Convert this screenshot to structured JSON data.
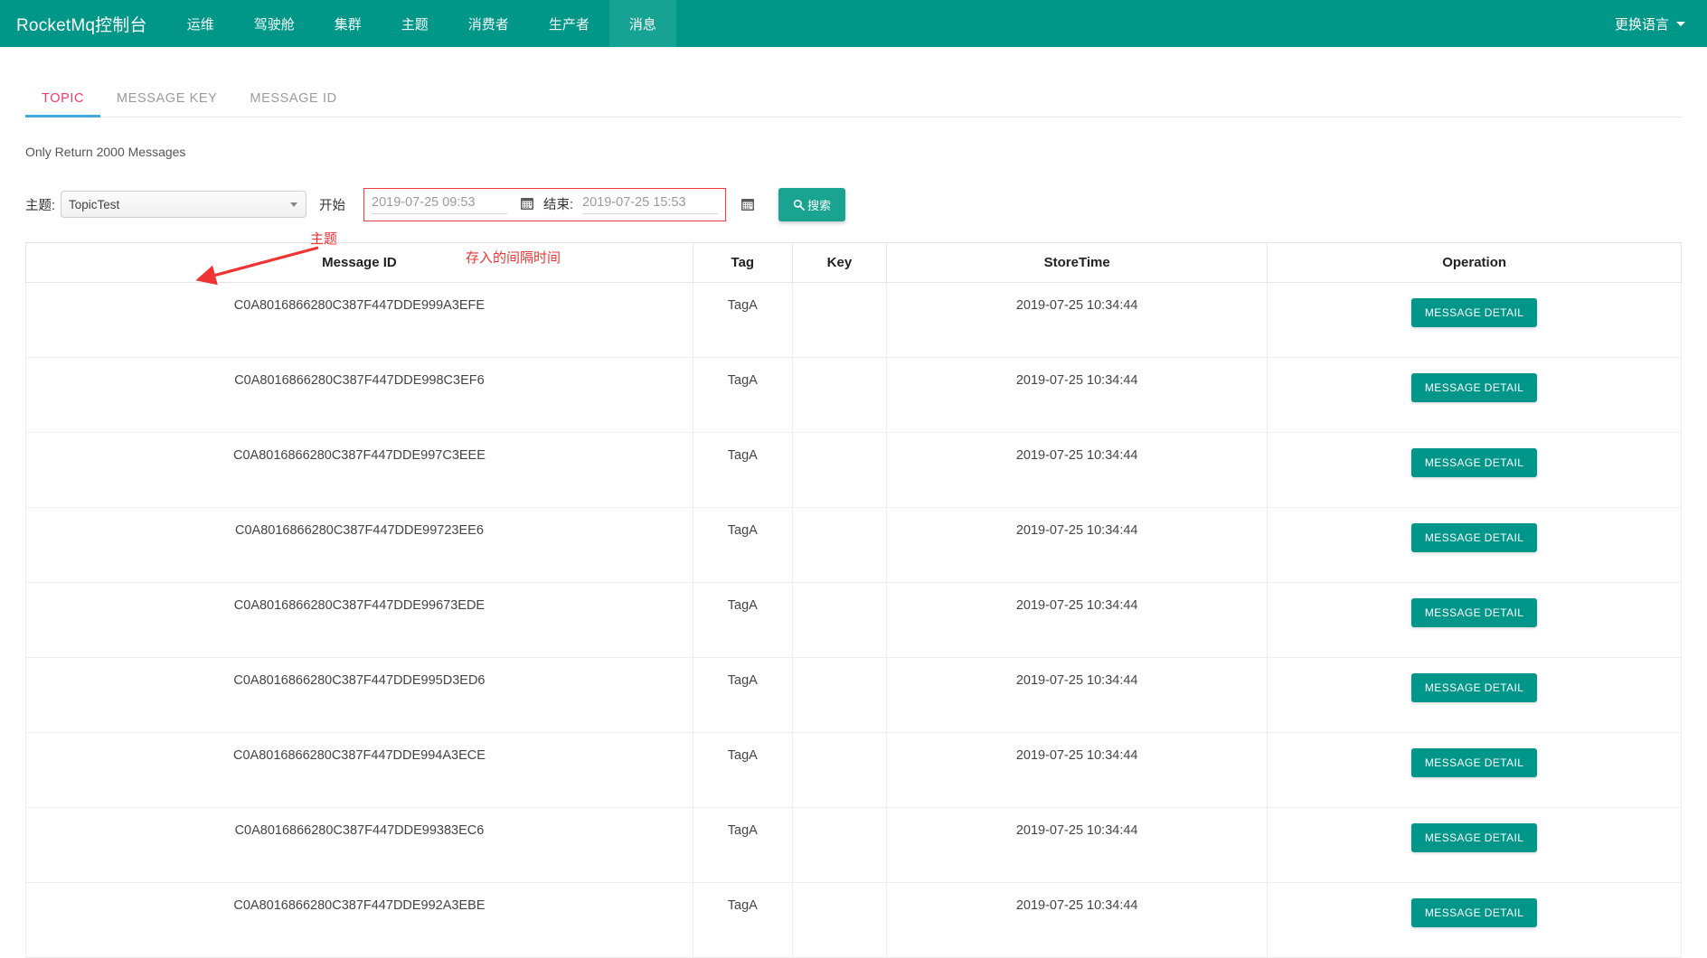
{
  "navbar": {
    "brand": "RocketMq控制台",
    "items": [
      {
        "label": "运维",
        "active": false
      },
      {
        "label": "驾驶舱",
        "active": false
      },
      {
        "label": "集群",
        "active": false
      },
      {
        "label": "主题",
        "active": false
      },
      {
        "label": "消费者",
        "active": false
      },
      {
        "label": "生产者",
        "active": false
      },
      {
        "label": "消息",
        "active": true
      }
    ],
    "language_label": "更换语言",
    "background_color": "#009688",
    "active_tab_color": "#17a394"
  },
  "tabs": [
    {
      "label": "TOPIC",
      "active": true
    },
    {
      "label": "MESSAGE KEY",
      "active": false
    },
    {
      "label": "MESSAGE ID",
      "active": false
    }
  ],
  "tab_active_color": "#ef3a69",
  "tab_underline_color": "#41a8e0",
  "query": {
    "notice": "Only Return 2000 Messages",
    "topic_label": "主题:",
    "topic_value": "TopicTest",
    "begin_label": "开始",
    "begin_value": "2019-07-25 09:53",
    "end_label": "结束:",
    "end_value": "2019-07-25 15:53",
    "search_label": "搜索",
    "search_button_color": "#1ba391"
  },
  "annotations": [
    {
      "text": "主题",
      "color": "#f03434"
    },
    {
      "text": "存入的间隔时间",
      "color": "#f03434"
    }
  ],
  "table": {
    "headers": [
      "Message ID",
      "Tag",
      "Key",
      "StoreTime",
      "Operation"
    ],
    "detail_button_label": "MESSAGE DETAIL",
    "detail_button_color": "#00968a",
    "rows": [
      {
        "message_id": "C0A8016866280C387F447DDE999A3EFE",
        "tag": "TagA",
        "key": "",
        "store_time": "2019-07-25 10:34:44"
      },
      {
        "message_id": "C0A8016866280C387F447DDE998C3EF6",
        "tag": "TagA",
        "key": "",
        "store_time": "2019-07-25 10:34:44"
      },
      {
        "message_id": "C0A8016866280C387F447DDE997C3EEE",
        "tag": "TagA",
        "key": "",
        "store_time": "2019-07-25 10:34:44"
      },
      {
        "message_id": "C0A8016866280C387F447DDE99723EE6",
        "tag": "TagA",
        "key": "",
        "store_time": "2019-07-25 10:34:44"
      },
      {
        "message_id": "C0A8016866280C387F447DDE99673EDE",
        "tag": "TagA",
        "key": "",
        "store_time": "2019-07-25 10:34:44"
      },
      {
        "message_id": "C0A8016866280C387F447DDE995D3ED6",
        "tag": "TagA",
        "key": "",
        "store_time": "2019-07-25 10:34:44"
      },
      {
        "message_id": "C0A8016866280C387F447DDE994A3ECE",
        "tag": "TagA",
        "key": "",
        "store_time": "2019-07-25 10:34:44"
      },
      {
        "message_id": "C0A8016866280C387F447DDE99383EC6",
        "tag": "TagA",
        "key": "",
        "store_time": "2019-07-25 10:34:44"
      },
      {
        "message_id": "C0A8016866280C387F447DDE992A3EBE",
        "tag": "TagA",
        "key": "",
        "store_time": "2019-07-25 10:34:44"
      }
    ]
  }
}
